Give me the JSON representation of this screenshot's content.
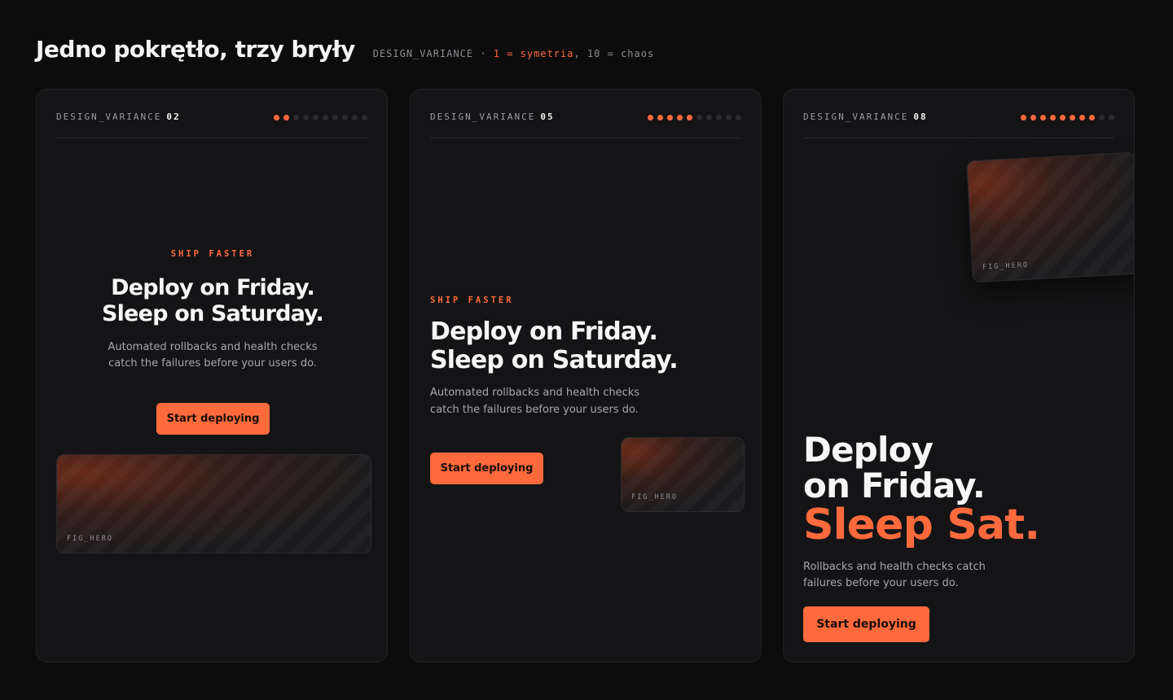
{
  "page": {
    "title": "Jedno pokrętło, trzy bryły",
    "legend": {
      "key": "DESIGN_VARIANCE",
      "separator": "·",
      "low": "1 = symetria",
      "comma": ",",
      "high": "10 = chaos"
    }
  },
  "colors": {
    "background": "#0c0c0d",
    "card": "#141416",
    "accent": "#ff6a3d",
    "text": "#f6f6f7",
    "muted": "#a7a7ad"
  },
  "cards": [
    {
      "label": "DESIGN_VARIANCE",
      "value": "02",
      "level": 2,
      "dots_total": 10,
      "eyebrow": "SHIP FASTER",
      "headline_line1": "Deploy on Friday.",
      "headline_line2": "Sleep on Saturday.",
      "body": "Automated rollbacks and health checks catch the failures before your users do.",
      "cta": "Start deploying",
      "figure_label": "FIG_HERO"
    },
    {
      "label": "DESIGN_VARIANCE",
      "value": "05",
      "level": 5,
      "dots_total": 10,
      "eyebrow": "SHIP FASTER",
      "headline_line1": "Deploy on Friday.",
      "headline_line2": "Sleep on Saturday.",
      "body": "Automated rollbacks and health checks catch the failures before your users do.",
      "cta": "Start deploying",
      "figure_label": "FIG_HERO"
    },
    {
      "label": "DESIGN_VARIANCE",
      "value": "08",
      "level": 8,
      "dots_total": 10,
      "headline_line1": "Deploy",
      "headline_line2": "on Friday.",
      "headline_accent": "Sleep Sat.",
      "body": "Rollbacks and health checks catch failures before your users do.",
      "cta": "Start deploying",
      "figure_label": "FIG_HERO"
    }
  ]
}
